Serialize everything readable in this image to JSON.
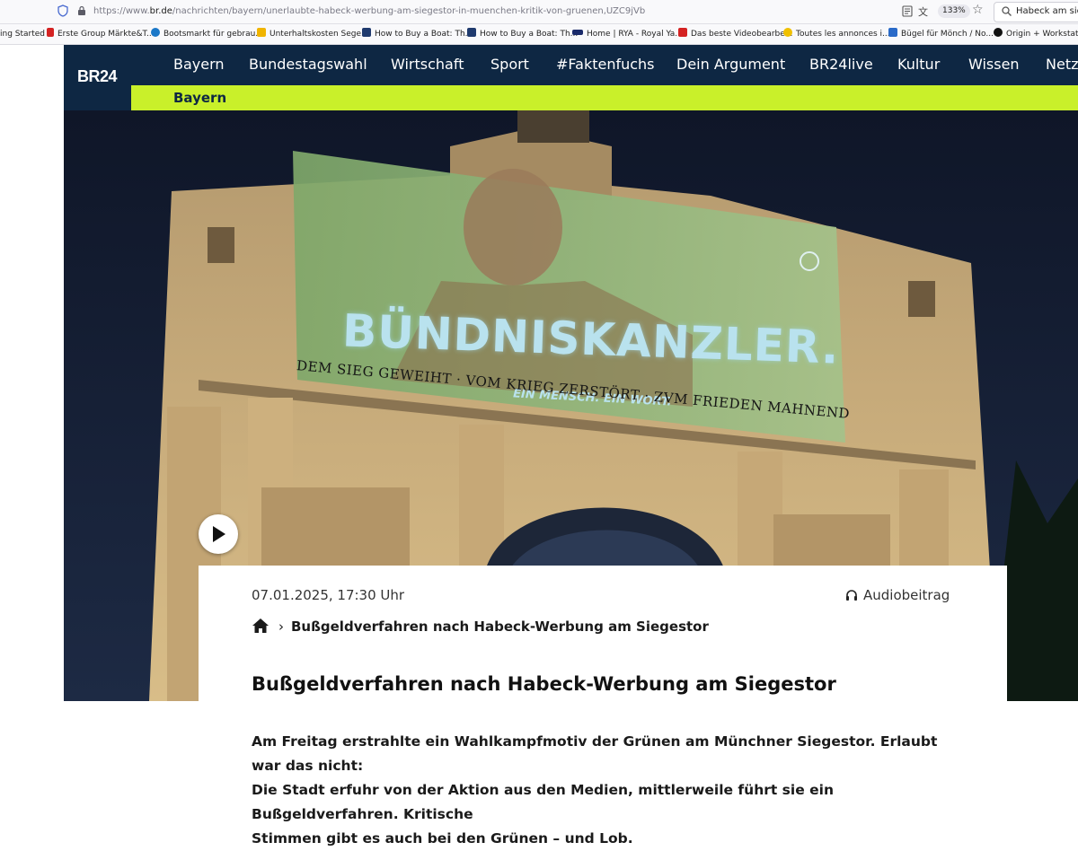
{
  "browser": {
    "url_prefix": "https://www.",
    "url_domain": "br.de",
    "url_path": "/nachrichten/bayern/unerlaubte-habeck-werbung-am-siegestor-in-muenchen-kritik-von-gruenen,UZC9jVb",
    "zoom": "133%",
    "search_text": "Habeck am sieg"
  },
  "bookmarks": [
    {
      "label": "ing Started",
      "color": ""
    },
    {
      "label": "Erste Group Märkte&T...",
      "color": "#d42222"
    },
    {
      "label": "Bootsmarkt für gebrau...",
      "color": "#1b78c8"
    },
    {
      "label": "Unterhaltskosten Sege...",
      "color": "#f0b400"
    },
    {
      "label": "How to Buy a Boat: Th...",
      "color": "#1f3a6e"
    },
    {
      "label": "How to Buy a Boat: Th...",
      "color": "#1f3a6e"
    },
    {
      "label": "Home | RYA - Royal Ya...",
      "color": "#1a2a6a"
    },
    {
      "label": "Das beste Videobearbe...",
      "color": "#d42222"
    },
    {
      "label": "Toutes les annonces i...",
      "color": "#f0c000"
    },
    {
      "label": "Bügel für Mönch / No...",
      "color": "#2a6ac8"
    },
    {
      "label": "Origin + Workstation",
      "color": "#111111"
    }
  ],
  "site": {
    "logo": "BR24",
    "nav": [
      "Bayern",
      "Bundestagswahl",
      "Wirtschaft",
      "Sport",
      "#Faktenfuchs",
      "Dein Argument",
      "BR24live",
      "Kultur",
      "Wissen",
      "Netz"
    ],
    "subnav": "Bayern",
    "brand_blue": "#0e2743",
    "brand_green": "#c9f02a"
  },
  "hero": {
    "projection_headline": "BÜNDNISKANZLER.",
    "projection_tagline": "EIN MENSCH. EIN WORT.",
    "inscription": "DEM SIEG GEWEIHT · VOM KRIEG ZERSTÖRT · ZVM FRIEDEN MAHNEND"
  },
  "article": {
    "date": "07.01.2025, 17:30 Uhr",
    "audio_label": "Audiobeitrag",
    "breadcrumb_current": "Bußgeldverfahren nach Habeck-Werbung am Siegestor",
    "title": "Bußgeldverfahren nach Habeck-Werbung am Siegestor",
    "lead_lines": [
      "Am Freitag erstrahlte ein Wahlkampfmotiv der Grünen am Münchner Siegestor. Erlaubt war das nicht:",
      "Die Stadt erfuhr von der Aktion aus den Medien, mittlerweile führt sie ein Bußgeldverfahren. Kritische",
      "Stimmen gibt es auch bei den Grünen – und Lob."
    ]
  }
}
